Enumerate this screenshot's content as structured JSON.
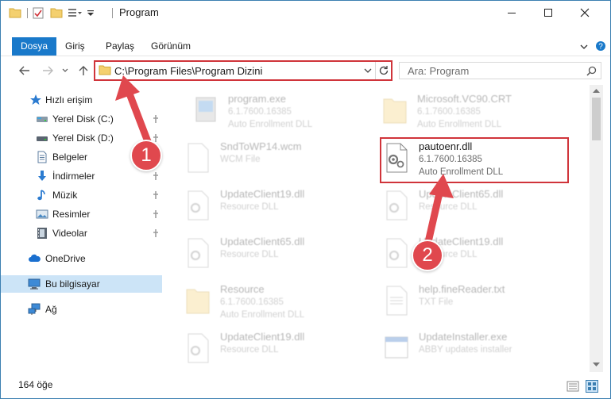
{
  "window": {
    "title": "Program",
    "controls": {
      "minimize": "—",
      "maximize": "☐",
      "close": "✕"
    }
  },
  "ribbon": {
    "tabs": [
      {
        "label": "Dosya",
        "active": true
      },
      {
        "label": "Giriş"
      },
      {
        "label": "Paylaş"
      },
      {
        "label": "Görünüm"
      }
    ]
  },
  "nav": {
    "address": "C:\\Program Files\\Program Dizini",
    "search_placeholder": "Ara: Program"
  },
  "sidebar": {
    "items": [
      {
        "label": "Hızlı erişim",
        "icon": "star-icon"
      },
      {
        "label": "Yerel Disk (C:)",
        "icon": "drive-icon",
        "pinned": true
      },
      {
        "label": "Yerel Disk (D:)",
        "icon": "drive-icon",
        "pinned": true
      },
      {
        "label": "Belgeler",
        "icon": "document-icon",
        "pinned": true
      },
      {
        "label": "İndirmeler",
        "icon": "download-icon",
        "pinned": true
      },
      {
        "label": "Müzik",
        "icon": "music-icon",
        "pinned": true
      },
      {
        "label": "Resimler",
        "icon": "pictures-icon",
        "pinned": true
      },
      {
        "label": "Videolar",
        "icon": "video-icon",
        "pinned": true
      },
      {
        "label": "OneDrive",
        "icon": "cloud-icon"
      },
      {
        "label": "Bu bilgisayar",
        "icon": "computer-icon",
        "selected": true
      },
      {
        "label": "Ağ",
        "icon": "network-icon"
      }
    ]
  },
  "files": [
    {
      "name": "program.exe",
      "version": "6.1.7600.16385",
      "desc": "Auto Enrollment DLL",
      "icon": "exe-icon"
    },
    {
      "name": "Microsoft.VC90.CRT",
      "version": "6.1.7600.16385",
      "desc": "Auto Enrollment DLL",
      "icon": "folder-icon"
    },
    {
      "name": "SndToWP14.wcm",
      "version": "WCM File",
      "desc": "",
      "icon": "file-icon"
    },
    {
      "name": "pautoenr.dll",
      "version": "6.1.7600.16385",
      "desc": "Auto Enrollment DLL",
      "icon": "dll-icon",
      "highlighted": true
    },
    {
      "name": "UpdateClient19.dll",
      "version": "Resource DLL",
      "desc": "",
      "icon": "dll-icon"
    },
    {
      "name": "UpdateClient65.dll",
      "version": "Resource DLL",
      "desc": "",
      "icon": "dll-icon"
    },
    {
      "name": "UpdateClient65.dll",
      "version": "Resource DLL",
      "desc": "",
      "icon": "dll-icon"
    },
    {
      "name": "UpdateClient19.dll",
      "version": "Resource DLL",
      "desc": "",
      "icon": "dll-icon"
    },
    {
      "name": "Resource",
      "version": "6.1.7600.16385",
      "desc": "Auto Enrollment DLL",
      "icon": "folder-icon"
    },
    {
      "name": "help.fineReader.txt",
      "version": "TXT File",
      "desc": "",
      "icon": "file-icon"
    },
    {
      "name": "UpdateClient19.dll",
      "version": "Resource DLL",
      "desc": "",
      "icon": "dll-icon"
    },
    {
      "name": "UpdateInstaller.exe",
      "version": "ABBY updates installer",
      "desc": "",
      "icon": "exe-icon"
    }
  ],
  "status": {
    "count": "164 öğe"
  },
  "callouts": {
    "one": "1",
    "two": "2"
  },
  "colors": {
    "accent": "#1979ca",
    "highlight": "#d0343a",
    "selected": "#cce4f7"
  }
}
